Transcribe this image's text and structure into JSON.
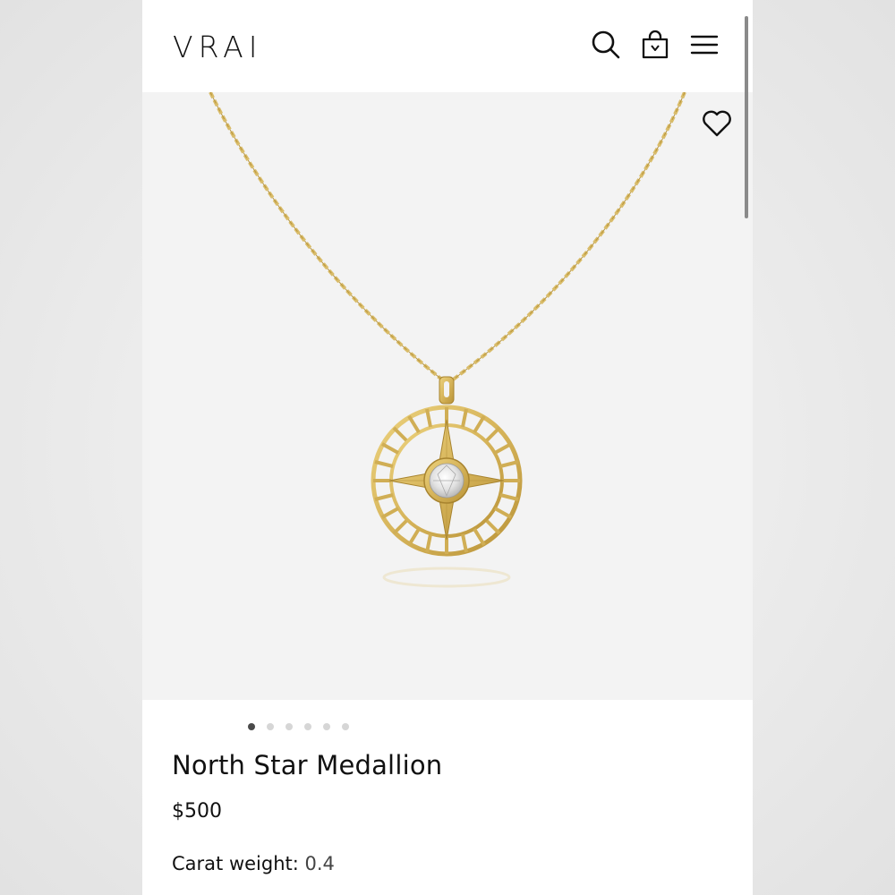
{
  "header": {
    "logo": "VRAI",
    "icons": [
      "search-icon",
      "shopping-bag-icon",
      "menu-icon"
    ]
  },
  "gallery": {
    "image": "gold compass-star medallion necklace with center diamond",
    "favorite_icon": "heart-icon",
    "slide_count": 6,
    "active_slide": 1
  },
  "product": {
    "title": "North Star Medallion",
    "price": "$500",
    "carat_label": "Carat weight:",
    "carat_value": "0.4"
  },
  "colors": {
    "gold": "#d7b862",
    "gold_dark": "#b8953e",
    "text": "#111111",
    "gallery_bg": "#f3f3f3"
  }
}
